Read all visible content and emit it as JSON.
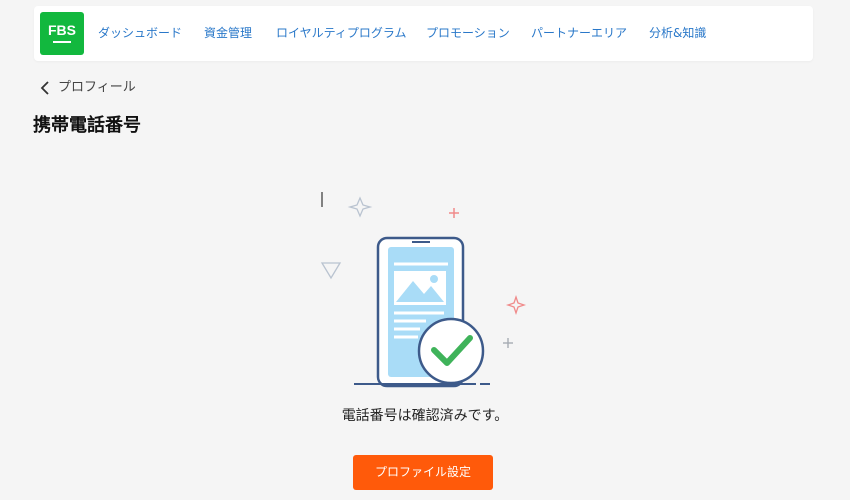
{
  "logo": {
    "text": "FBS"
  },
  "nav": {
    "items": [
      {
        "label": "ダッシュボード"
      },
      {
        "label": "資金管理"
      },
      {
        "label": "ロイヤルティプログラム"
      },
      {
        "label": "プロモーション"
      },
      {
        "label": "パートナーエリア"
      },
      {
        "label": "分析&知識"
      }
    ]
  },
  "breadcrumb": {
    "back_label": "プロフィール",
    "icon": "chevron-left-icon"
  },
  "page": {
    "title": "携帯電話番号"
  },
  "status": {
    "message": "電話番号は確認済みです。",
    "icon": "phone-verified-check-icon"
  },
  "actions": {
    "profile_settings_label": "プロファイル設定"
  },
  "colors": {
    "brand_green": "#12b83e",
    "link_blue": "#2a78c9",
    "button_orange": "#ff5a0a",
    "check_green": "#3fb35a",
    "background": "#f5f5f5"
  }
}
